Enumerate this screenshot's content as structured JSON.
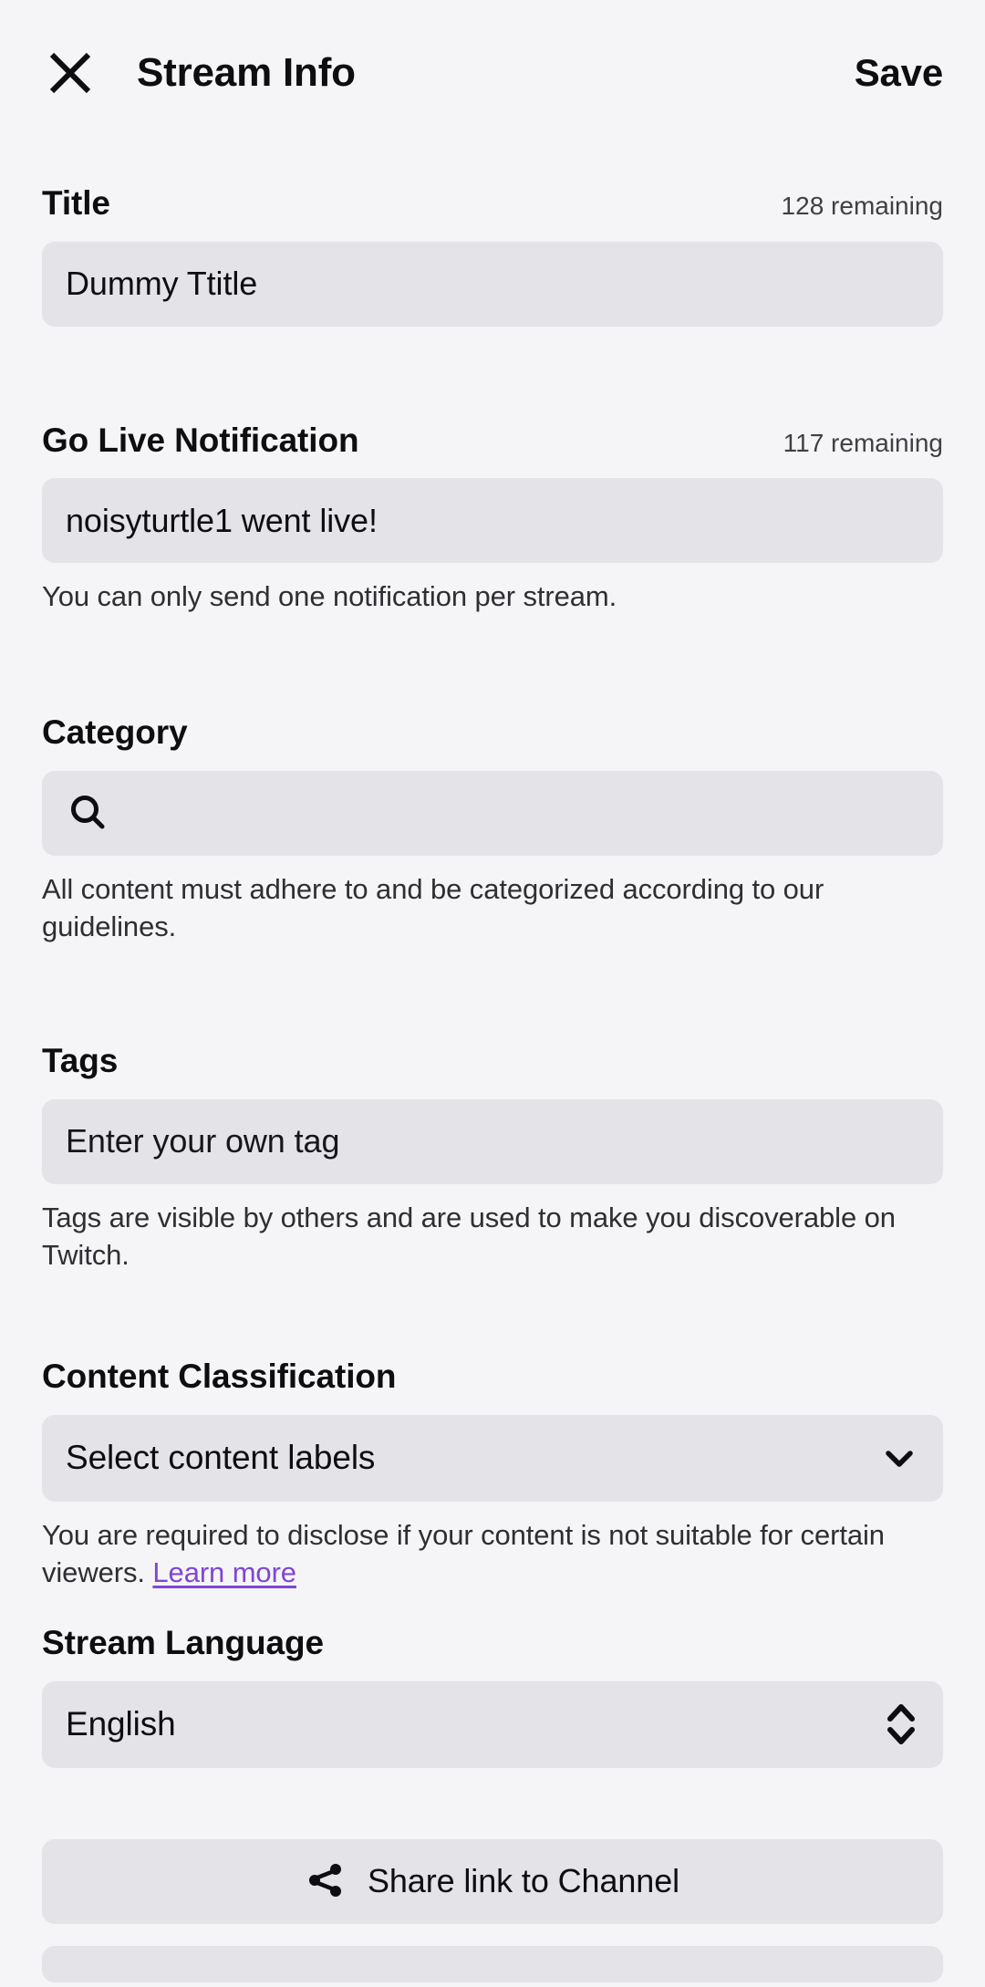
{
  "header": {
    "close_icon": "close-icon",
    "title": "Stream Info",
    "save_label": "Save"
  },
  "title_section": {
    "label": "Title",
    "counter": "128 remaining",
    "value": "Dummy Ttitle"
  },
  "go_live_section": {
    "label": "Go Live Notification",
    "counter": "117 remaining",
    "value": "noisyturtle1 went live!",
    "helper": "You can only send one notification per stream."
  },
  "category_section": {
    "label": "Category",
    "search_icon": "search-icon",
    "value": "",
    "placeholder": "",
    "helper": "All content must adhere to and be categorized according to our guidelines."
  },
  "tags_section": {
    "label": "Tags",
    "value": "Enter your own tag",
    "helper": "Tags are visible by others and are used to make you discoverable on Twitch."
  },
  "content_classification": {
    "label": "Content Classification",
    "value": "Select content labels",
    "chevron_icon": "chevron-down-icon",
    "helper_text": "You are required to disclose if your content is not suitable for certain viewers. ",
    "link_label": "Learn more",
    "link_color": "#7f46d4"
  },
  "stream_language": {
    "label": "Stream Language",
    "value": "English",
    "stepper_icon": "chevron-up-down-icon"
  },
  "share": {
    "icon": "share-icon",
    "label": "Share link to Channel"
  },
  "colors": {
    "background": "#f5f5f7",
    "field_fill": "#e3e3e8",
    "text": "#0e0e10",
    "link": "#7f46d4"
  }
}
